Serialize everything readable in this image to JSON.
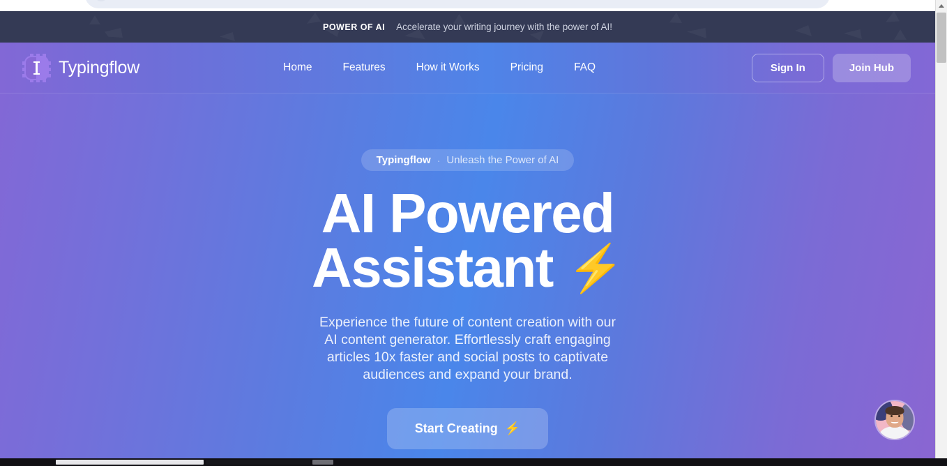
{
  "browser": {
    "omnibox_value": ""
  },
  "announcement": {
    "tag": "POWER OF AI",
    "text": "Accelerate your writing journey with the power of AI!"
  },
  "header": {
    "brand_name": "Typingflow",
    "logo_icon": "ai-chip-cursor-icon",
    "nav": [
      {
        "label": "Home"
      },
      {
        "label": "Features"
      },
      {
        "label": "How it Works"
      },
      {
        "label": "Pricing"
      },
      {
        "label": "FAQ"
      }
    ],
    "sign_in_label": "Sign In",
    "join_hub_label": "Join Hub"
  },
  "hero": {
    "badge_brand": "Typingflow",
    "badge_separator": "·",
    "badge_tag": "Unleash the Power of AI",
    "title_line1": "AI Powered",
    "title_line2": "Assistant",
    "title_bolt_icon": "⚡",
    "subtitle": "Experience the future of content creation with our AI content generator. Effortlessly craft engaging articles 10x faster and social posts to captivate audiences and expand your brand.",
    "cta_label": "Start Creating",
    "cta_bolt_icon": "⚡",
    "avatar_icon": "user-avatar-photo"
  },
  "colors": {
    "banner_bg": "#343a55",
    "gradient_purple": "#8268d6",
    "gradient_blue": "#4a86ea",
    "logo_purple": "#9b7bea",
    "text_white": "#ffffff"
  }
}
